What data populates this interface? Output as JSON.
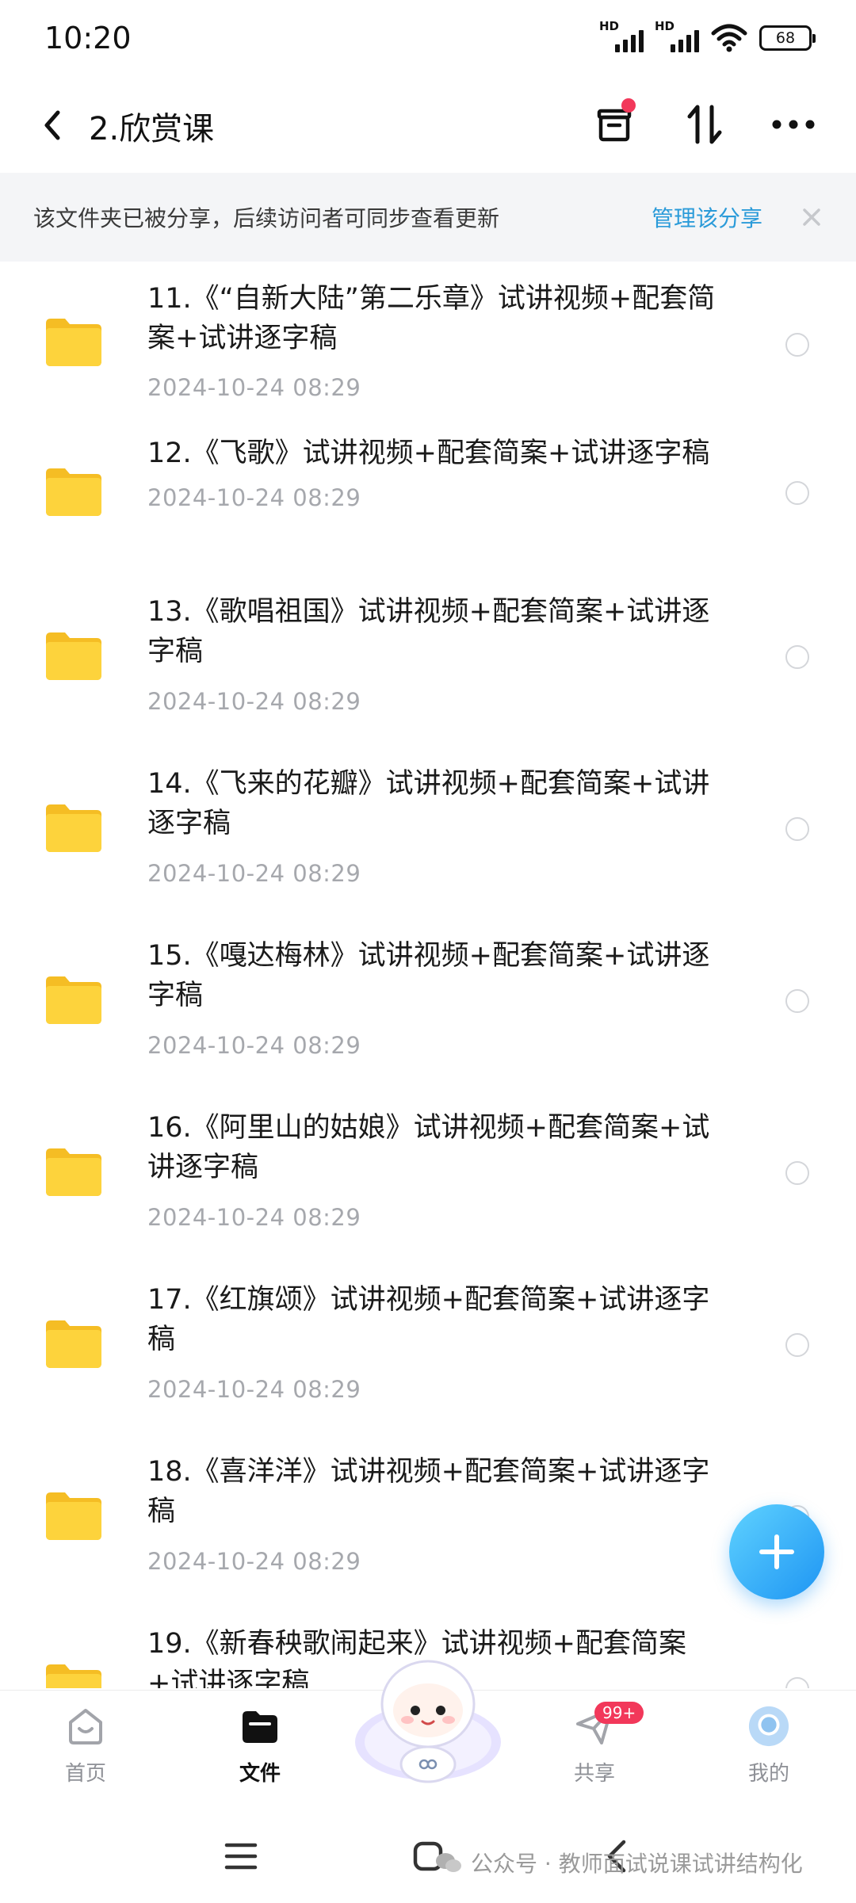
{
  "status_bar": {
    "time": "10:20",
    "signal1_label": "HD",
    "signal2_label": "HD",
    "battery": "68"
  },
  "header": {
    "title": "2.欣赏课",
    "back_icon": "chevron-left-icon",
    "icons": [
      "archive-box-icon",
      "sort-arrows-icon",
      "more-dots-icon"
    ]
  },
  "banner": {
    "text": "该文件夹已被分享，后续访问者可同步查看更新",
    "link": "管理该分享",
    "close_icon": "close-icon"
  },
  "files": [
    {
      "name_line1": "11.《“自新大陆”第二乐章》试讲视频+配套简",
      "name_line2": "案+试讲逐字稿",
      "date": "2024-10-24  08:29"
    },
    {
      "name_line1": "12.《飞歌》试讲视频+配套简案+试讲逐字稿",
      "name_line2": "",
      "date": "2024-10-24  08:29"
    },
    {
      "name_line1": "13.《歌唱祖国》试讲视频+配套简案+试讲逐",
      "name_line2": "字稿",
      "date": "2024-10-24  08:29"
    },
    {
      "name_line1": "14.《飞来的花瓣》试讲视频+配套简案+试讲",
      "name_line2": "逐字稿",
      "date": "2024-10-24  08:29"
    },
    {
      "name_line1": "15.《嘎达梅林》试讲视频+配套简案+试讲逐",
      "name_line2": "字稿",
      "date": "2024-10-24  08:29"
    },
    {
      "name_line1": "16.《阿里山的姑娘》试讲视频+配套简案+试",
      "name_line2": "讲逐字稿",
      "date": "2024-10-24  08:29"
    },
    {
      "name_line1": "17.《红旗颂》试讲视频+配套简案+试讲逐字",
      "name_line2": "稿",
      "date": "2024-10-24  08:29"
    },
    {
      "name_line1": "18.《喜洋洋》试讲视频+配套简案+试讲逐字",
      "name_line2": "稿",
      "date": "2024-10-24  08:29"
    },
    {
      "name_line1": "19.《新春秧歌闹起来》试讲视频+配套简案",
      "name_line2": "+试讲逐字稿",
      "date": ""
    }
  ],
  "fab": {
    "icon": "plus-icon"
  },
  "bottom_nav": {
    "home": "首页",
    "files": "文件",
    "share": "共享",
    "share_badge": "99+",
    "me": "我的"
  },
  "watermark": "公众号 · 教师面试说课试讲结构化",
  "colors": {
    "accent": "#2b9bd9",
    "badge": "#f2385a",
    "folder": "#fdd33c",
    "date_gray": "#a6a8ad"
  }
}
